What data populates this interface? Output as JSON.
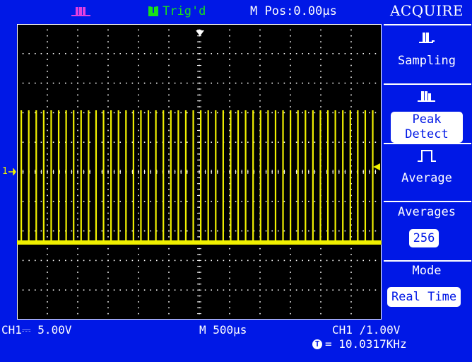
{
  "top_bar": {
    "run_state_icon": "pulse-icon",
    "trigger_icon": "T",
    "trigger_status": "Trig'd",
    "horizontal_position": "M Pos:0.00µs"
  },
  "menu": {
    "title": "ACQUIRE",
    "items": [
      {
        "label": "Sampling",
        "icon": "sampling-pulse-icon"
      },
      {
        "label": "Peak\nDetect",
        "icon": "peak-detect-pulse-icon"
      },
      {
        "label": "Average",
        "icon": "average-pulse-icon"
      },
      {
        "label": "Averages",
        "value": "256"
      },
      {
        "label": "Mode",
        "value": "Real Time"
      }
    ]
  },
  "status_bar": {
    "channel_scale": "CH1⎓ 5.00V",
    "timebase": "M 500µs",
    "trigger_setting": "CH1 ∕1.00V",
    "frequency_icon": "T",
    "frequency": "= 10.0317KHz"
  },
  "waveform": {
    "channel": "CH1",
    "pulse_count": 48,
    "channel_marker": "1",
    "colors": {
      "trace": "#f0f000",
      "grid": "#ffffff",
      "background": "#000000",
      "frame": "#0018e6"
    }
  }
}
